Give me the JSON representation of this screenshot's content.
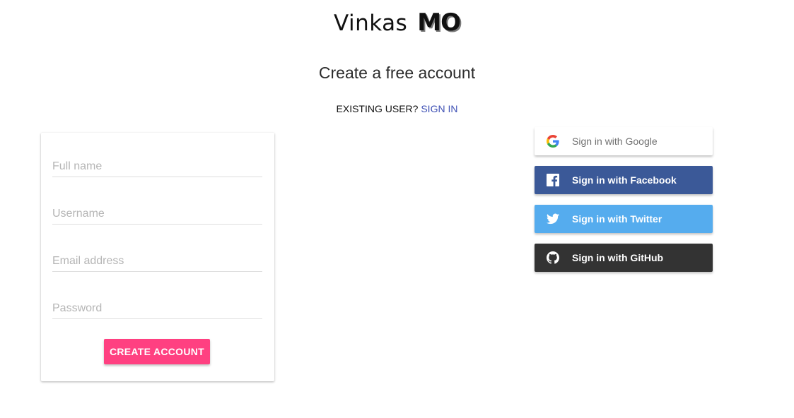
{
  "logo": {
    "word": "Vinkas",
    "mark": "MO"
  },
  "heading": "Create a free account",
  "existing": {
    "prompt": "EXISTING USER?",
    "link": "SIGN IN"
  },
  "form": {
    "fields": [
      {
        "placeholder": "Full name",
        "value": ""
      },
      {
        "placeholder": "Username",
        "value": ""
      },
      {
        "placeholder": "Email address",
        "value": ""
      },
      {
        "placeholder": "Password",
        "value": ""
      }
    ],
    "submit_label": "CREATE ACCOUNT",
    "submit_color": "#ff4081"
  },
  "social": [
    {
      "label": "Sign in with Google",
      "icon": "google-icon",
      "color": "#ffffff"
    },
    {
      "label": "Sign in with Facebook",
      "icon": "facebook-icon",
      "color": "#3b5998"
    },
    {
      "label": "Sign in with Twitter",
      "icon": "twitter-icon",
      "color": "#55acee"
    },
    {
      "label": "Sign in with GitHub",
      "icon": "github-icon",
      "color": "#333333"
    }
  ]
}
